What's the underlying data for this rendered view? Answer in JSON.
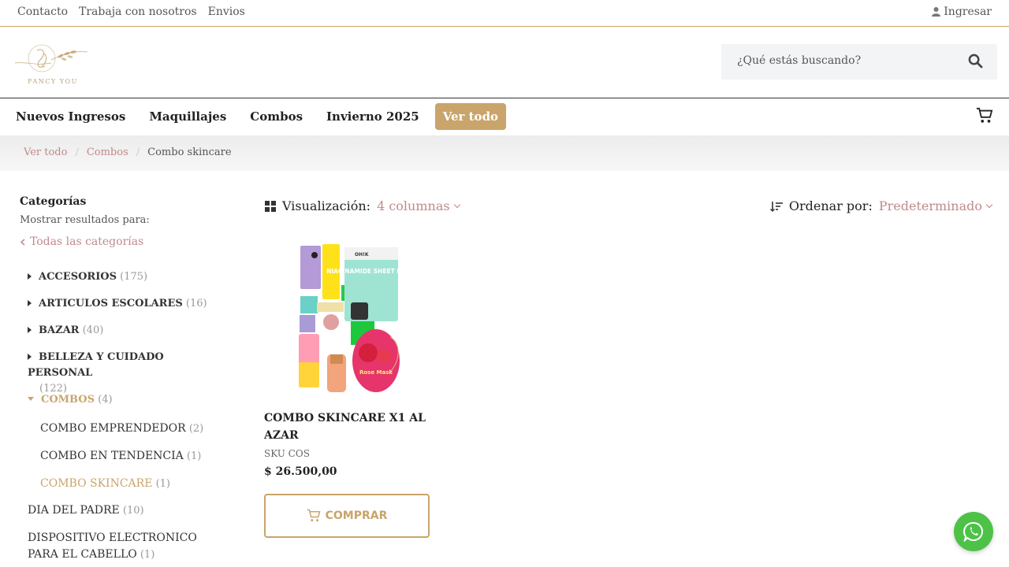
{
  "topbar": {
    "links": [
      "Contacto",
      "Trabaja con nosotros",
      "Envios"
    ],
    "login": "Ingresar"
  },
  "header": {
    "logo_text": "FANCY YOU",
    "search_placeholder": "¿Qué estás buscando?"
  },
  "nav": {
    "items": [
      "Nuevos Ingresos",
      "Maquillajes",
      "Combos",
      "Invierno 2025"
    ],
    "cta": "Ver todo"
  },
  "breadcrumb": {
    "items": [
      "Ver todo",
      "Combos"
    ],
    "current": "Combo skincare",
    "separator": "/"
  },
  "sidebar": {
    "title": "Categorías",
    "subtitle": "Mostrar resultados para:",
    "all": "Todas las categorías",
    "categories": [
      {
        "name": "ACCESORIOS",
        "count": "(175)"
      },
      {
        "name": "ARTICULOS ESCOLARES",
        "count": "(16)"
      },
      {
        "name": "BAZAR",
        "count": "(40)"
      },
      {
        "name": "BELLEZA Y CUIDADO PERSONAL",
        "count": "(122)"
      },
      {
        "name": "COMBOS",
        "count": "(4)"
      }
    ],
    "subcategories": [
      {
        "name": "COMBO EMPRENDEDOR",
        "count": "(2)"
      },
      {
        "name": "COMBO EN TENDENCIA",
        "count": "(1)"
      },
      {
        "name": "COMBO SKINCARE",
        "count": "(1)"
      }
    ],
    "others": [
      {
        "name": "DIA DEL PADRE",
        "count": "(10)"
      },
      {
        "name": "DISPOSITIVO ELECTRONICO PARA EL CABELLO",
        "count": "(1)"
      }
    ]
  },
  "toolbar": {
    "view_label": "Visualización:",
    "view_value": "4 columnas",
    "sort_label": "Ordenar por:",
    "sort_value": "Predeterminado"
  },
  "product": {
    "title": "COMBO SKINCARE X1 AL AZAR",
    "sku": "SKU COS",
    "price": "$  26.500,00",
    "buy_label": "COMPRAR",
    "image_text": {
      "mask": "NIACINAMIDE SHEET MASK",
      "brand": "OH!K",
      "rose": "Rose Mask"
    }
  },
  "colors": {
    "accent": "#c9a46b",
    "link": "#c08a8a",
    "whatsapp": "#4dc247"
  }
}
